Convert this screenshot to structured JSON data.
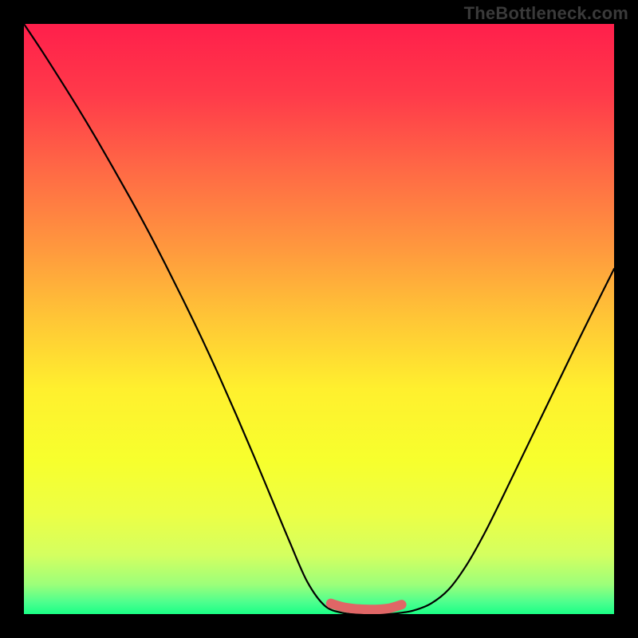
{
  "watermark": "TheBottleneck.com",
  "chart_data": {
    "type": "line",
    "title": "",
    "xlabel": "",
    "ylabel": "",
    "xlim": [
      0,
      100
    ],
    "ylim": [
      0,
      100
    ],
    "series": [
      {
        "name": "curve",
        "x": [
          0,
          3,
          6,
          9,
          12,
          15,
          18,
          21,
          24,
          27,
          30,
          33,
          36,
          39,
          42,
          45,
          48,
          51,
          54,
          57,
          59,
          61,
          63,
          66,
          69,
          72,
          75,
          78,
          81,
          84,
          87,
          90,
          93,
          96,
          100
        ],
        "y": [
          100,
          95.5,
          90.8,
          86,
          81,
          75.8,
          70.5,
          65,
          59.2,
          53.2,
          47,
          40.5,
          33.7,
          26.7,
          19.5,
          12.3,
          5.5,
          1.4,
          0.2,
          0,
          0,
          0,
          0.1,
          0.6,
          1.8,
          4.2,
          8.3,
          13.6,
          19.6,
          25.8,
          32,
          38.2,
          44.4,
          50.5,
          58.5
        ]
      },
      {
        "name": "highlight-band",
        "x": [
          52,
          54,
          56,
          58,
          60,
          62,
          64
        ],
        "y": [
          1.8,
          1.2,
          0.9,
          0.8,
          0.8,
          1.0,
          1.6
        ]
      }
    ],
    "gradient_stops": [
      {
        "offset": 0.0,
        "color": "#ff1f4b"
      },
      {
        "offset": 0.12,
        "color": "#ff3a4a"
      },
      {
        "offset": 0.25,
        "color": "#ff6a45"
      },
      {
        "offset": 0.38,
        "color": "#ff983e"
      },
      {
        "offset": 0.5,
        "color": "#ffc636"
      },
      {
        "offset": 0.62,
        "color": "#fff02e"
      },
      {
        "offset": 0.74,
        "color": "#f7ff2d"
      },
      {
        "offset": 0.83,
        "color": "#ecff45"
      },
      {
        "offset": 0.9,
        "color": "#d4ff60"
      },
      {
        "offset": 0.95,
        "color": "#9cff7a"
      },
      {
        "offset": 0.98,
        "color": "#4dff8e"
      },
      {
        "offset": 1.0,
        "color": "#1aff86"
      }
    ],
    "highlight_color": "#e06666",
    "curve_color": "#000000"
  }
}
